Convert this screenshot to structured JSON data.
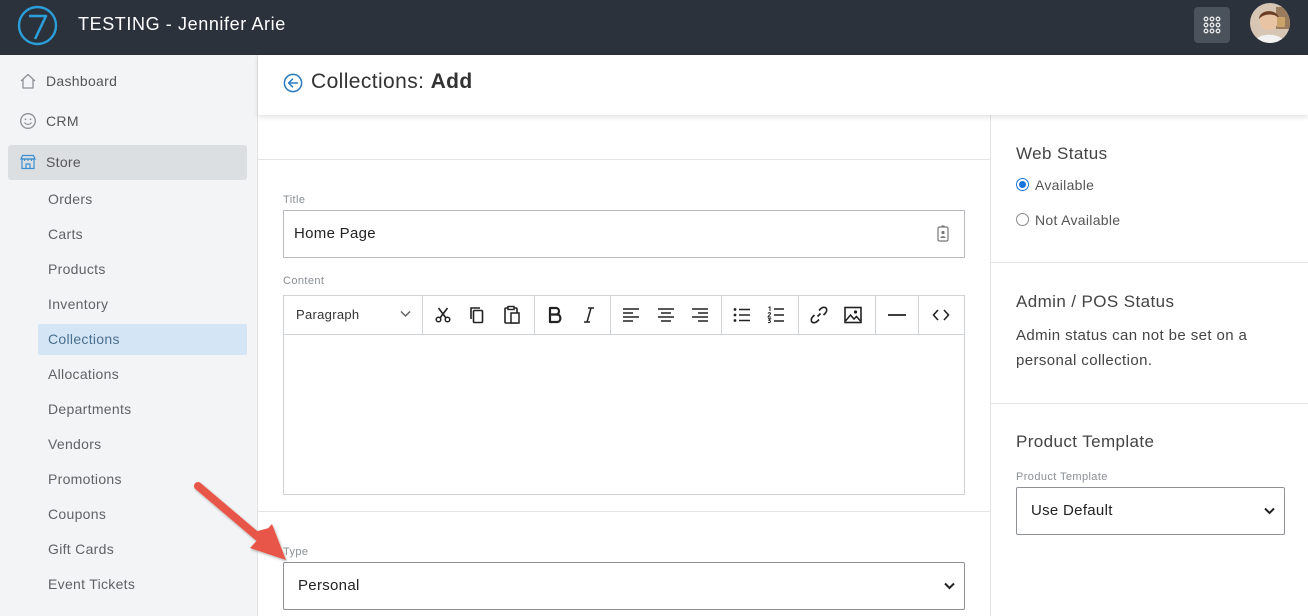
{
  "app": {
    "title": "TESTING - Jennifer Arie",
    "colors": {
      "topbar": "#2b323c",
      "accent": "#1a73d9",
      "arrow": "#e8574a"
    }
  },
  "sidebar": {
    "items": [
      {
        "label": "Dashboard",
        "icon": "home-icon"
      },
      {
        "label": "CRM",
        "icon": "smiley-icon"
      },
      {
        "label": "Store",
        "icon": "store-icon",
        "active": true
      }
    ],
    "store_subitems": [
      "Orders",
      "Carts",
      "Products",
      "Inventory",
      "Collections",
      "Allocations",
      "Departments",
      "Vendors",
      "Promotions",
      "Coupons",
      "Gift Cards",
      "Event Tickets"
    ],
    "active_subitem": "Collections"
  },
  "header": {
    "title_prefix": "Collections:",
    "title_action": "Add"
  },
  "form": {
    "title_label": "Title",
    "title_value": "Home Page",
    "content_label": "Content",
    "editor": {
      "block_format": "Paragraph",
      "toolbar_icons": [
        "cut-icon",
        "copy-icon",
        "paste-icon",
        "bold-icon",
        "italic-icon",
        "align-left-icon",
        "align-center-icon",
        "align-right-icon",
        "bullet-list-icon",
        "numbered-list-icon",
        "link-icon",
        "image-icon",
        "horizontal-rule-icon",
        "code-icon"
      ]
    },
    "type_label": "Type",
    "type_value": "Personal"
  },
  "right_panel": {
    "web_status": {
      "title": "Web Status",
      "options": [
        "Available",
        "Not Available"
      ],
      "selected": "Available"
    },
    "admin_status": {
      "title": "Admin / POS Status",
      "text": "Admin status can not be set on a personal collection."
    },
    "product_template": {
      "title": "Product Template",
      "field_label": "Product Template",
      "value": "Use Default"
    }
  }
}
